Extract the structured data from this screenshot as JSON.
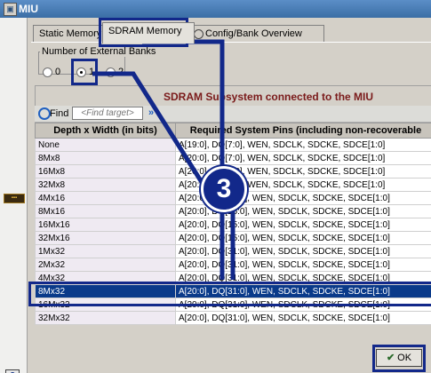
{
  "window": {
    "title": "MIU"
  },
  "tabs": [
    {
      "label": "Static Memory"
    },
    {
      "label": "SDRAM Memory"
    },
    {
      "label": "Config/Bank Overview"
    }
  ],
  "banks": {
    "label": "Number of External Banks",
    "options": [
      "0",
      "1",
      "2"
    ],
    "selected": "1"
  },
  "subsystem": {
    "title": "SDRAM Subsystem connected to the MIU"
  },
  "find": {
    "label": "Find",
    "placeholder": "<Find target>"
  },
  "table": {
    "headers": [
      "Depth x Width (in bits)",
      "Required System Pins (including non-recoverable"
    ],
    "rows": [
      [
        "None",
        "A[19:0], DQ[7:0], WEN, SDCLK, SDCKE, SDCE[1:0]"
      ],
      [
        "8Mx8",
        "A[20:0], DQ[7:0], WEN, SDCLK, SDCKE, SDCE[1:0]"
      ],
      [
        "16Mx8",
        "A[20:0], DQ[7:0], WEN, SDCLK, SDCKE, SDCE[1:0]"
      ],
      [
        "32Mx8",
        "A[20:0], DQ[7:0], WEN, SDCLK, SDCKE, SDCE[1:0]"
      ],
      [
        "4Mx16",
        "A[20:0], DQ[15:0], WEN, SDCLK, SDCKE, SDCE[1:0]"
      ],
      [
        "8Mx16",
        "A[20:0], DQ[15:0], WEN, SDCLK, SDCKE, SDCE[1:0]"
      ],
      [
        "16Mx16",
        "A[20:0], DQ[15:0], WEN, SDCLK, SDCKE, SDCE[1:0]"
      ],
      [
        "32Mx16",
        "A[20:0], DQ[15:0], WEN, SDCLK, SDCKE, SDCE[1:0]"
      ],
      [
        "1Mx32",
        "A[20:0], DQ[31:0], WEN, SDCLK, SDCKE, SDCE[1:0]"
      ],
      [
        "2Mx32",
        "A[20:0], DQ[31:0], WEN, SDCLK, SDCKE, SDCE[1:0]"
      ],
      [
        "4Mx32",
        "A[20:0], DQ[31:0], WEN, SDCLK, SDCKE, SDCE[1:0]"
      ],
      [
        "8Mx32",
        "A[20:0], DQ[31:0], WEN, SDCLK, SDCKE, SDCE[1:0]"
      ],
      [
        "16Mx32",
        "A[20:0], DQ[31:0], WEN, SDCLK, SDCKE, SDCE[1:0]"
      ],
      [
        "32Mx32",
        "A[20:0], DQ[31:0], WEN, SDCLK, SDCKE, SDCE[1:0]"
      ]
    ],
    "selected_index": 11
  },
  "buttons": {
    "ok": "OK"
  },
  "callout": {
    "number": "3"
  },
  "colors": {
    "highlight": "#12288a",
    "selection": "#0a3a8a",
    "title_bar": "#3b6ea5"
  }
}
